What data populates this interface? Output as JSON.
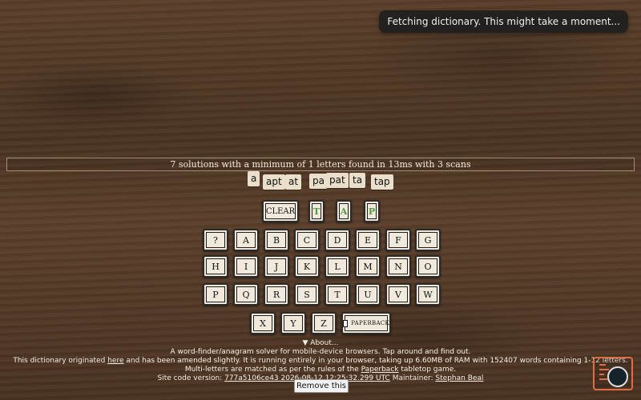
{
  "toast": {
    "text": "Fetching dictionary. This might take a moment..."
  },
  "status": {
    "text": "7 solutions with a minimum of 1 letters found in 13ms with 3 scans"
  },
  "words": [
    "a",
    "apt",
    "at",
    "pa",
    "pat",
    "ta",
    "tap"
  ],
  "controls": {
    "clear_label": "CLEAR",
    "selected_letters": [
      "T",
      "A",
      "P"
    ],
    "paperback_label": "PAPERBACK"
  },
  "keyboard": {
    "row1": [
      "?",
      "A",
      "B",
      "C",
      "D",
      "E",
      "F",
      "G"
    ],
    "row2": [
      "H",
      "I",
      "J",
      "K",
      "L",
      "M",
      "N",
      "O"
    ],
    "row3": [
      "P",
      "Q",
      "R",
      "S",
      "T",
      "U",
      "V",
      "W"
    ],
    "row4": [
      "X",
      "Y",
      "Z"
    ]
  },
  "about": {
    "toggle_label": "▼ About...",
    "desc": "A word-finder/anagram solver for mobile-device browsers. Tap around and find out.",
    "origin_prefix": "This dictionary originated ",
    "origin_link": "here",
    "origin_suffix": " and has been amended slightly. It is running entirely in your browser, taking up 6.60MB of RAM with 152407 words containing 1-12 letters.",
    "multi_prefix": "Multi-letters are matched as per the rules of the ",
    "multi_link": "Paperback",
    "multi_suffix": " tabletop game.",
    "site_prefix": "Site code version: ",
    "site_version": "777a5106ce43 2026-08-12 12:25:32.299 UTC",
    "maintainer_prefix": " Maintainer: ",
    "maintainer": "Stephan Beal"
  },
  "remove_label": "Remove this",
  "icons": {
    "corner_logo": "app-logo-icon",
    "corner_circle": "ghost-avatar-icon"
  },
  "colors": {
    "selected_letter": "#4d9b3f",
    "wood_base": "#4b3322",
    "tile": "#eadfca"
  }
}
